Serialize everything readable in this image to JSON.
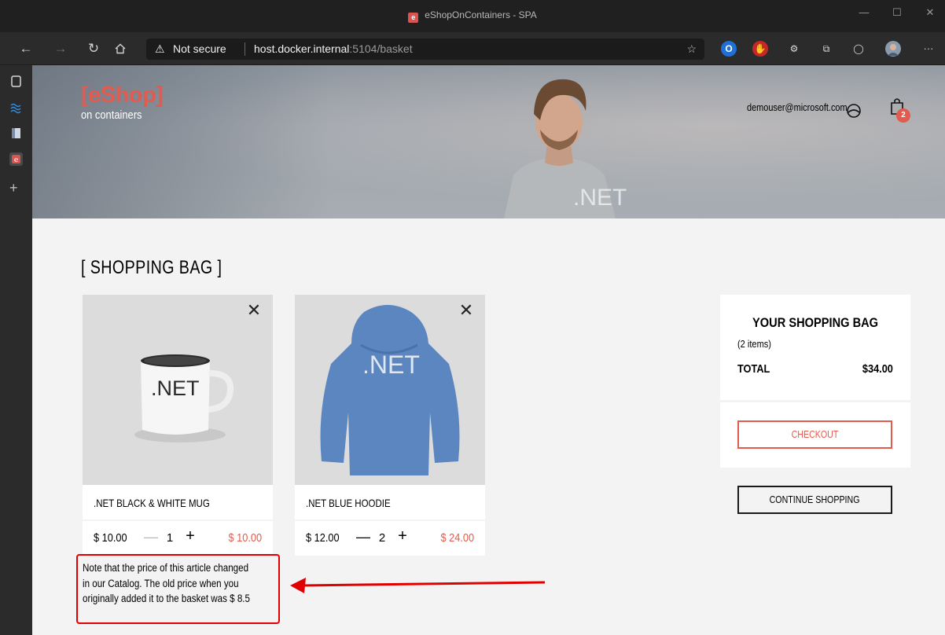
{
  "window": {
    "title": "eShopOnContainers - SPA",
    "favicon_letter": "e",
    "minimize": "—",
    "maximize": "☐",
    "close": "✕"
  },
  "browser": {
    "security_label": "Not secure",
    "url_host": "host.docker.internal",
    "url_rest": ":5104/basket",
    "more_label": "···"
  },
  "header": {
    "brand": "[eShop]",
    "brand_sub": "on containers",
    "user_email": "demouser@microsoft.com",
    "bag_count": "2",
    "hero_shirt_text": ".NET"
  },
  "basket": {
    "title": "[ SHOPPING BAG ]",
    "items": [
      {
        "image_text": ".NET",
        "name": ".NET BLACK & WHITE MUG",
        "unit_price": "$ 10.00",
        "quantity": "1",
        "total": "$ 10.00",
        "minus": "—",
        "plus": "+",
        "close": "✕"
      },
      {
        "image_text": ".NET",
        "name": ".NET BLUE HOODIE",
        "unit_price": "$ 12.00",
        "quantity": "2",
        "total": "$ 24.00",
        "minus": "—",
        "plus": "+",
        "close": "✕"
      }
    ],
    "price_change_note": {
      "line1": "Note that the price of this article changed",
      "line2": "in our Catalog. The old price when you",
      "line3": "originally added it to the basket was $ 8.5"
    }
  },
  "summary": {
    "title": "YOUR SHOPPING BAG",
    "item_count": "(2 items)",
    "total_label": "TOTAL",
    "total_value": "$34.00",
    "checkout_label": "CHECKOUT",
    "continue_label": "CONTINUE SHOPPING"
  },
  "colors": {
    "accent": "#e35b4e",
    "annotation_red": "#e00000",
    "page_bg": "#f3f3f3",
    "chrome_dark": "#202020"
  }
}
